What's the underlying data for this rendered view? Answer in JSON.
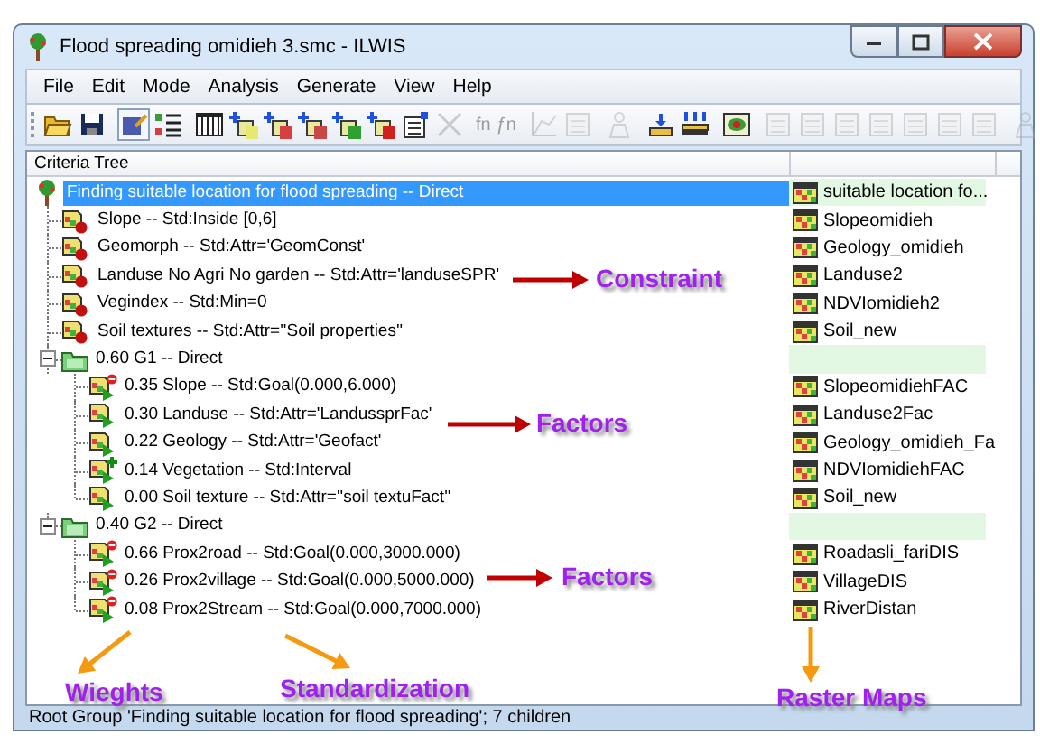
{
  "window": {
    "title": "Flood spreading omidieh 3.smc - ILWIS"
  },
  "menu": [
    "File",
    "Edit",
    "Mode",
    "Analysis",
    "Generate",
    "View",
    "Help"
  ],
  "toolbar": [
    {
      "kind": "folder",
      "disabled": false,
      "pressed": false
    },
    {
      "kind": "disk",
      "disabled": false,
      "pressed": false
    },
    {
      "kind": "sep"
    },
    {
      "kind": "doc",
      "disabled": false,
      "pressed": true
    },
    {
      "kind": "list",
      "disabled": false,
      "pressed": false
    },
    {
      "kind": "sep"
    },
    {
      "kind": "table",
      "disabled": false,
      "pressed": false
    },
    {
      "kind": "add",
      "color": "#e8e870",
      "disabled": false,
      "pressed": false
    },
    {
      "kind": "add",
      "color": "#d84040",
      "disabled": false,
      "pressed": false
    },
    {
      "kind": "add",
      "color": "#c84848",
      "disabled": false,
      "pressed": false
    },
    {
      "kind": "add",
      "color": "#30a030",
      "disabled": false,
      "pressed": false
    },
    {
      "kind": "add",
      "color": "#d02020",
      "disabled": false,
      "pressed": false
    },
    {
      "kind": "props",
      "disabled": false,
      "pressed": false
    },
    {
      "kind": "cross",
      "disabled": true,
      "pressed": false
    },
    {
      "kind": "sep"
    },
    {
      "kind": "fn",
      "label": "fn",
      "disabled": true,
      "pressed": false
    },
    {
      "kind": "fn",
      "label": "ƒn",
      "disabled": true,
      "pressed": false
    },
    {
      "kind": "sep"
    },
    {
      "kind": "chart",
      "disabled": true,
      "pressed": false
    },
    {
      "kind": "sheet",
      "disabled": true,
      "pressed": false
    },
    {
      "kind": "sep"
    },
    {
      "kind": "figure",
      "disabled": true,
      "pressed": false
    },
    {
      "kind": "sep"
    },
    {
      "kind": "stack",
      "disabled": false,
      "pressed": false
    },
    {
      "kind": "grid",
      "disabled": false,
      "pressed": false
    },
    {
      "kind": "sep"
    },
    {
      "kind": "eye",
      "disabled": false,
      "pressed": false
    },
    {
      "kind": "sep"
    },
    {
      "kind": "sheet",
      "disabled": true,
      "pressed": false
    },
    {
      "kind": "sheet",
      "disabled": true,
      "pressed": false
    },
    {
      "kind": "sheet",
      "disabled": true,
      "pressed": false
    },
    {
      "kind": "sheet",
      "disabled": true,
      "pressed": false
    },
    {
      "kind": "sheet",
      "disabled": true,
      "pressed": false
    },
    {
      "kind": "sheet",
      "disabled": true,
      "pressed": false
    },
    {
      "kind": "sheet",
      "disabled": true,
      "pressed": false
    },
    {
      "kind": "sep"
    },
    {
      "kind": "figure",
      "disabled": true,
      "pressed": false
    }
  ],
  "tree_header": "Criteria Tree",
  "tree": [
    {
      "kind": "root",
      "label": "Finding suitable location for flood spreading -- Direct",
      "map": "suitable location fo...",
      "selected": true,
      "children": [
        {
          "kind": "constraint",
          "label": "Slope -- Std:Inside [0,6]",
          "map": "Slopeomidieh",
          "selected": false
        },
        {
          "kind": "constraint",
          "label": "Geomorph -- Std:Attr='GeomConst'",
          "map": "Geology_omidieh",
          "selected": false
        },
        {
          "kind": "constraint",
          "label": "Landuse No Agri No garden -- Std:Attr='landuseSPR'",
          "map": "Landuse2",
          "selected": false
        },
        {
          "kind": "constraint",
          "label": "Vegindex -- Std:Min=0",
          "map": "NDVIomidieh2",
          "selected": false
        },
        {
          "kind": "constraint",
          "label": "Soil textures -- Std:Attr=''Soil properties''",
          "map": "Soil_new",
          "selected": false
        },
        {
          "kind": "group",
          "label": "0.60 G1 -- Direct",
          "selected": false,
          "expanded": true,
          "children": [
            {
              "kind": "factor",
              "minus_badge": true,
              "plus_badge": false,
              "label": "0.35 Slope -- Std:Goal(0.000,6.000)",
              "map": "SlopeomidiehFAC",
              "selected": false
            },
            {
              "kind": "factor",
              "minus_badge": false,
              "plus_badge": false,
              "label": "0.30 Landuse -- Std:Attr='LandussprFac'",
              "map": "Landuse2Fac",
              "selected": false
            },
            {
              "kind": "factor",
              "minus_badge": false,
              "plus_badge": false,
              "label": "0.22 Geology -- Std:Attr='Geofact'",
              "map": "Geology_omidieh_Fa",
              "selected": false
            },
            {
              "kind": "factor",
              "minus_badge": false,
              "plus_badge": true,
              "label": "0.14 Vegetation -- Std:Interval",
              "map": "NDVIomidiehFAC",
              "selected": false
            },
            {
              "kind": "factor",
              "minus_badge": false,
              "plus_badge": false,
              "label": "0.00 Soil texture -- Std:Attr=''soil textuFact''",
              "map": "Soil_new",
              "selected": false
            }
          ]
        },
        {
          "kind": "group",
          "label": "0.40 G2 -- Direct",
          "selected": false,
          "expanded": true,
          "children": [
            {
              "kind": "factor",
              "minus_badge": true,
              "plus_badge": false,
              "label": "0.66 Prox2road -- Std:Goal(0.000,3000.000)",
              "map": "Roadasli_fariDIS",
              "selected": false
            },
            {
              "kind": "factor",
              "minus_badge": true,
              "plus_badge": false,
              "label": "0.26 Prox2village -- Std:Goal(0.000,5000.000)",
              "map": "VillageDIS",
              "selected": false
            },
            {
              "kind": "factor",
              "minus_badge": true,
              "plus_badge": false,
              "label": "0.08 Prox2Stream -- Std:Goal(0.000,7000.000)",
              "map": "RiverDistan",
              "selected": false
            }
          ]
        }
      ]
    }
  ],
  "status_bar": "Root Group 'Finding suitable location for flood spreading'; 7 children",
  "annotations": [
    {
      "text": "Constraint",
      "color": "#c00000"
    },
    {
      "text": "Factors",
      "color": "#c00000"
    },
    {
      "text": "Factors",
      "color": "#c00000"
    },
    {
      "text": "Wieghts",
      "color": "#f59a10"
    },
    {
      "text": "Standardization",
      "color": "#f59a10"
    },
    {
      "text": "Raster Maps",
      "color": "#f59a10"
    }
  ]
}
